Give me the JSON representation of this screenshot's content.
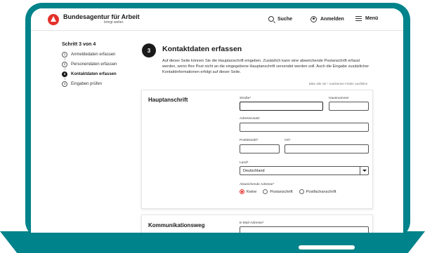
{
  "header": {
    "brand": "Bundesagentur für Arbeit",
    "tagline": "bringt weiter.",
    "search_label": "Suche",
    "login_label": "Anmelden",
    "menu_label": "Menü"
  },
  "stepper": {
    "title": "Schritt 3 von 4",
    "steps": [
      {
        "number": "1",
        "label": "Anmeldedaten erfassen"
      },
      {
        "number": "2",
        "label": "Personendaten erfassen"
      },
      {
        "number": "3",
        "label": "Kontaktdaten erfassen"
      },
      {
        "number": "4",
        "label": "Eingaben prüfen"
      }
    ],
    "active_step": 3
  },
  "main": {
    "step_number": "3",
    "title": "Kontaktdaten erfassen",
    "intro": "Auf dieser Seite können Sie die Hauptanschrift eingeben. Zusätzlich kann eine abweichende Postanschrift erfasst werden, wenn Ihre Post nicht an die eingegebene Hauptanschrift versendet werden soll. Auch die Eingabe zusätzlicher Kontaktinformationen erfolgt auf dieser Seite.",
    "required_note": "Bitte alle mit * markierten Felder ausfüllen"
  },
  "address": {
    "heading": "Hauptanschrift",
    "street_label": "Straße*",
    "street_value": "",
    "house_label": "Hausnummer",
    "house_value": "",
    "addition_label": "Adresszusatz",
    "addition_value": "",
    "zip_label": "Postleitzahl*",
    "zip_value": "",
    "city_label": "Ort*",
    "city_value": "",
    "country_label": "Land*",
    "country_value": "Deutschland",
    "alt_address_label": "Abweichende Adresse*",
    "alt_options": [
      "Keine",
      "Postanschrift",
      "Postfachanschrift"
    ],
    "alt_selected": "Keine"
  },
  "communication": {
    "heading": "Kommunikationsweg",
    "email_label": "E-Mail-Adresse*"
  },
  "colors": {
    "device": "#00838a",
    "accent_red": "#e4312b",
    "text": "#1a1a1a"
  }
}
